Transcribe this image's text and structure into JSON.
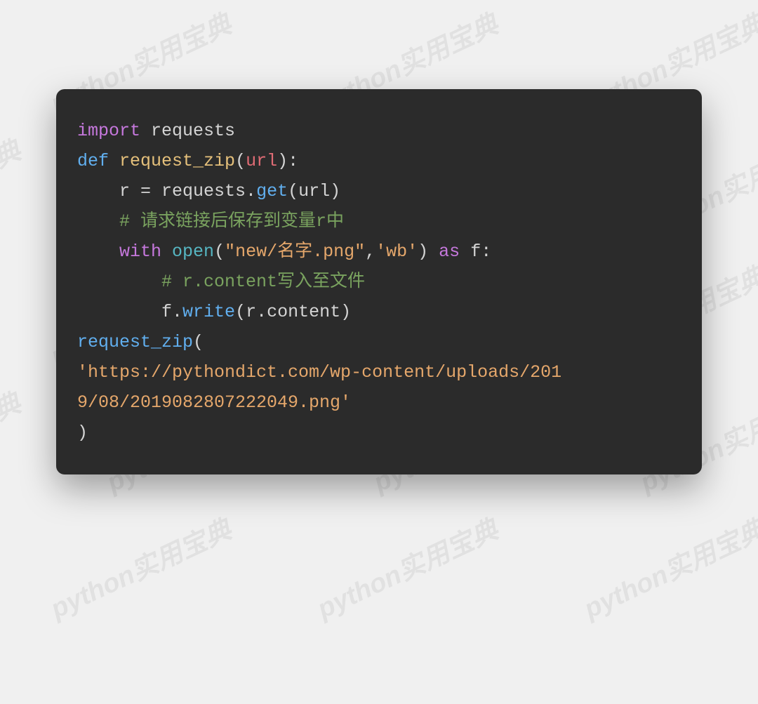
{
  "watermark": "python实用宝典",
  "code": {
    "line1": {
      "import_kw": "import",
      "module": "requests"
    },
    "line2": {
      "def_kw": "def",
      "fn": "request_zip",
      "open_paren": "(",
      "param": "url",
      "close": "):"
    },
    "line3": {
      "indent": "    ",
      "var": "r = requests.",
      "method": "get",
      "open": "(",
      "arg": "url",
      "close": ")"
    },
    "line4": {
      "indent": "    ",
      "comment": "# 请求链接后保存到变量r中"
    },
    "line5": {
      "indent": "    ",
      "with_kw": "with",
      "open_fn": "open",
      "open_paren": "(",
      "string1": "\"new/名字.png\"",
      "comma": ",",
      "string2": "'wb'",
      "close_paren": ")",
      "as_kw": "as",
      "var": "f",
      "colon": ":"
    },
    "line6": {
      "indent": "        ",
      "comment": "# r.content写入至文件"
    },
    "line7": {
      "indent": "        ",
      "text": "f.",
      "method": "write",
      "open": "(",
      "arg": "r.content",
      "close": ")"
    },
    "line8": {
      "fn": "request_zip",
      "open": "("
    },
    "line9": {
      "string": "'https://pythondict.com/wp-content/uploads/201"
    },
    "line10": {
      "string": "9/08/2019082807222049.png'"
    },
    "line11": {
      "close": ")"
    }
  }
}
